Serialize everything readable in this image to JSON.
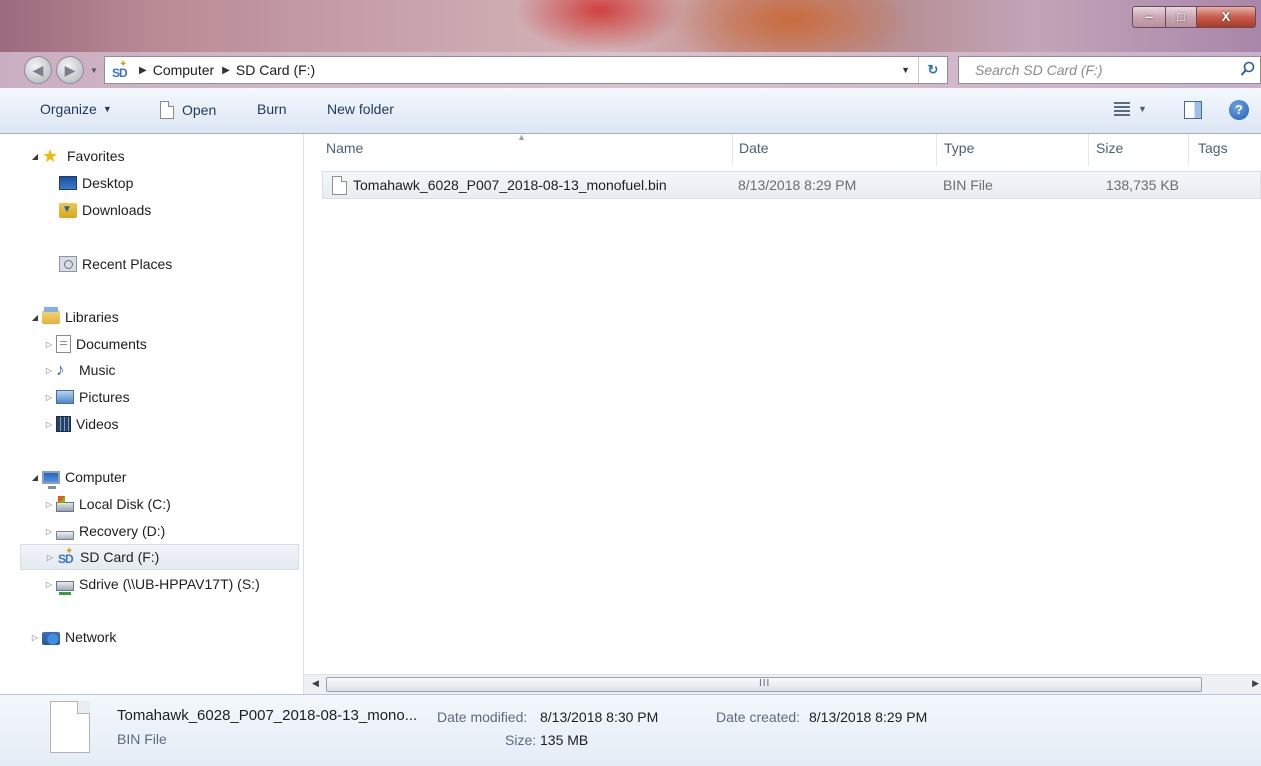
{
  "window": {
    "minimize": "‒",
    "maximize": "□",
    "close": "X"
  },
  "address": {
    "crumbs": [
      "Computer",
      "SD Card (F:)"
    ],
    "search_placeholder": "Search SD Card (F:)"
  },
  "toolbar": {
    "organize": "Organize",
    "open": "Open",
    "burn": "Burn",
    "new_folder": "New folder"
  },
  "nav": {
    "favorites": "Favorites",
    "desktop": "Desktop",
    "downloads": "Downloads",
    "recent_places": "Recent Places",
    "libraries": "Libraries",
    "documents": "Documents",
    "music": "Music",
    "pictures": "Pictures",
    "videos": "Videos",
    "computer": "Computer",
    "local_disk": "Local Disk (C:)",
    "recovery": "Recovery (D:)",
    "sd_card": "SD Card (F:)",
    "sdrive": "Sdrive (\\\\UB-HPPAV17T) (S:)",
    "network": "Network"
  },
  "columns": {
    "name": "Name",
    "date": "Date",
    "type": "Type",
    "size": "Size",
    "tags": "Tags"
  },
  "files": [
    {
      "name": "Tomahawk_6028_P007_2018-08-13_monofuel.bin",
      "date": "8/13/2018 8:29 PM",
      "type": "BIN File",
      "size": "138,735 KB"
    }
  ],
  "scrollbar": {
    "grip": "III"
  },
  "details": {
    "name": "Tomahawk_6028_P007_2018-08-13_mono...",
    "type": "BIN File",
    "modified_label": "Date modified:",
    "modified_value": "8/13/2018 8:30 PM",
    "size_label": "Size:",
    "size_value": "135 MB",
    "created_label": "Date created:",
    "created_value": "8/13/2018 8:29 PM"
  }
}
